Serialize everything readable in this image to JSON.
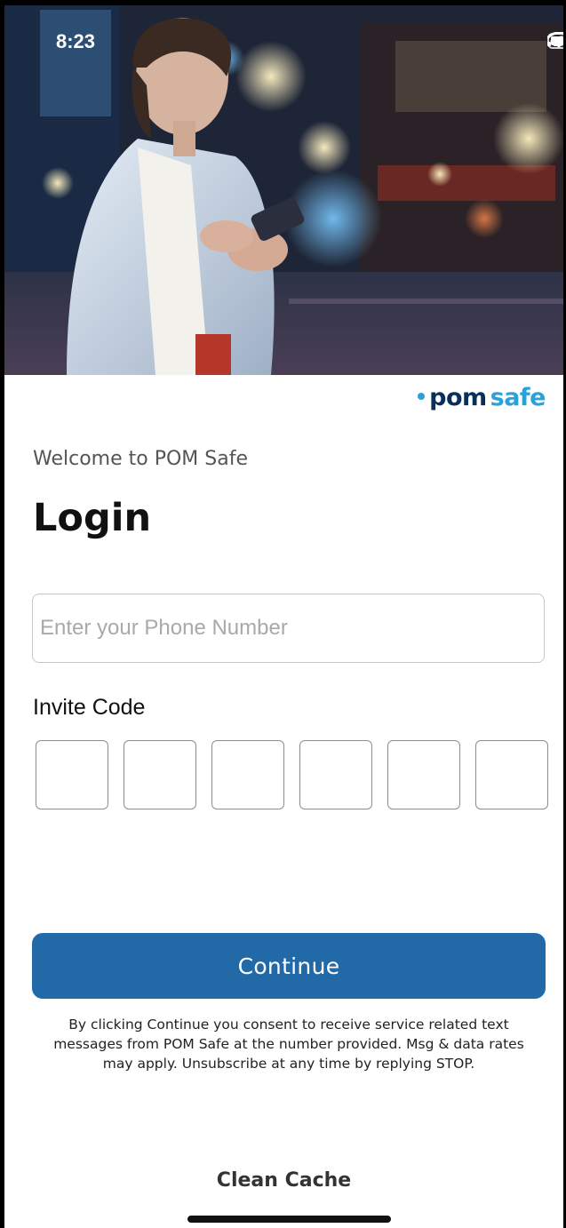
{
  "status_bar": {
    "time": "8:23"
  },
  "brand": {
    "pom": "pom",
    "safe": "safe"
  },
  "header": {
    "welcome": "Welcome to POM Safe",
    "title": "Login"
  },
  "phone": {
    "placeholder": "Enter your Phone Number",
    "value": ""
  },
  "invite": {
    "label": "Invite Code",
    "boxes": [
      "",
      "",
      "",
      "",
      "",
      ""
    ]
  },
  "actions": {
    "continue_label": "Continue",
    "consent_text": "By clicking Continue you consent to receive service related text messages from POM Safe at the number provided.  Msg & data rates may apply. Unsubscribe at any time by replying STOP.",
    "clean_cache_label": "Clean Cache"
  },
  "colors": {
    "primary_button": "#2269a8",
    "brand_navy": "#0b2f5b",
    "brand_cyan": "#2aa1d9"
  },
  "icons": [
    "cellular-signal-icon",
    "wifi-icon",
    "battery-icon"
  ]
}
